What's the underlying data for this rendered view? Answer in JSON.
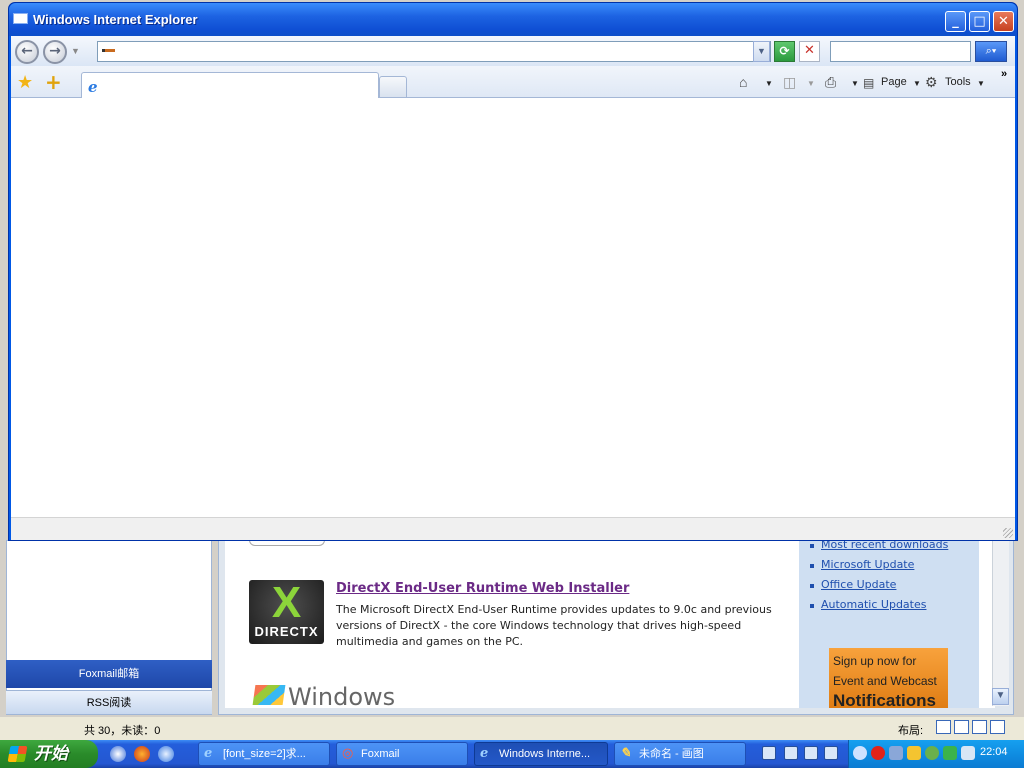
{
  "ie": {
    "title": "Windows Internet Explorer",
    "address_value": "",
    "search_value": "",
    "tab_title": "",
    "page_label": "Page",
    "tools_label": "Tools",
    "status_text": ""
  },
  "background_page": {
    "directx_logo_text": "DIRECTX",
    "directx_title": "DirectX End-User Runtime Web Installer",
    "directx_desc": "The Microsoft DirectX End-User Runtime provides updates to 9.0c and previous versions of DirectX - the core Windows technology that drives high-speed multimedia and games on the PC.",
    "windows_logo_text": "Windows",
    "links": [
      "Most recent downloads",
      "Microsoft Update",
      "Office Update",
      "Automatic Updates"
    ],
    "banner_lines": [
      "Sign up now for",
      "Event and Webcast",
      "Notifications"
    ]
  },
  "foxmail": {
    "mailbox_tab": "Foxmail邮箱",
    "rss_tab": "RSS阅读",
    "status_counts": "共 30，未读：0",
    "layout_label": "布局:"
  },
  "taskbar": {
    "start_label": "开始",
    "tasks": [
      {
        "label": "[font_size=2]求...",
        "icon": "ie-icon"
      },
      {
        "label": "Foxmail",
        "icon": "foxmail-icon"
      },
      {
        "label": "Windows Interne...",
        "icon": "ie-icon"
      },
      {
        "label": "未命名 - 画图",
        "icon": "paint-icon"
      }
    ],
    "clock": "22:04"
  }
}
